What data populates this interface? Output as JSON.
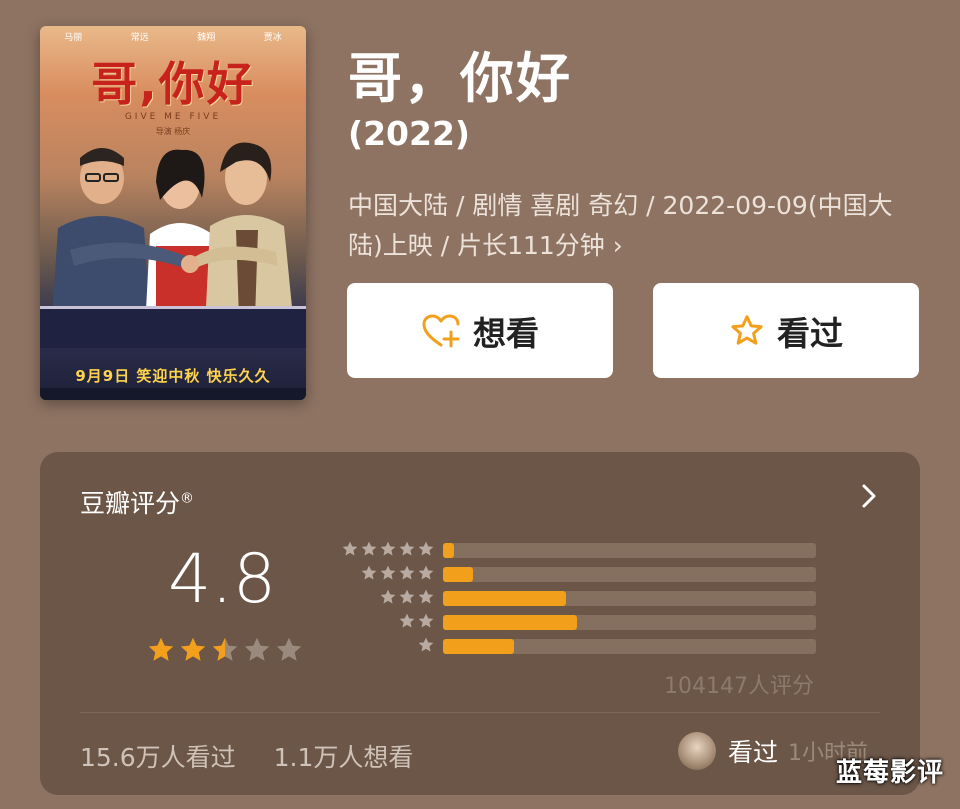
{
  "movie": {
    "title": "哥，你好",
    "year": "(2022)",
    "meta": "中国大陆 / 剧情 喜剧 奇幻 / 2022-09-09(中国大陆)上映 / 片长111分钟",
    "meta_chevron": "›",
    "poster": {
      "cast": [
        "马丽",
        "常远",
        "魏翔",
        "贾冰"
      ],
      "title": "哥,你好",
      "subtitle_en": "GIVE ME FIVE",
      "director": "导演 杨庆",
      "tagline": "9月9日 笑迎中秋 快乐久久"
    }
  },
  "actions": {
    "want_label": "想看",
    "seen_label": "看过"
  },
  "rating": {
    "label": "豆瓣评分",
    "registered_mark": "®",
    "score": "4.8",
    "stars_filled": 2.5,
    "stars_total": 5,
    "distribution": [
      {
        "stars": 5,
        "fraction": 0.03
      },
      {
        "stars": 4,
        "fraction": 0.08
      },
      {
        "stars": 3,
        "fraction": 0.33
      },
      {
        "stars": 2,
        "fraction": 0.36
      },
      {
        "stars": 1,
        "fraction": 0.19
      }
    ],
    "count_text": "104147人评分"
  },
  "footer": {
    "watched": "15.6万人看过",
    "want": "1.1万人想看",
    "friend_action": "看过",
    "friend_time": "1小时前"
  },
  "watermark": "蓝莓影评",
  "colors": {
    "background": "#8e7362",
    "card": "#6b5648",
    "accent": "#f2a01c",
    "bar_track": "#85705f",
    "dist_star": "#b8aaa0"
  }
}
